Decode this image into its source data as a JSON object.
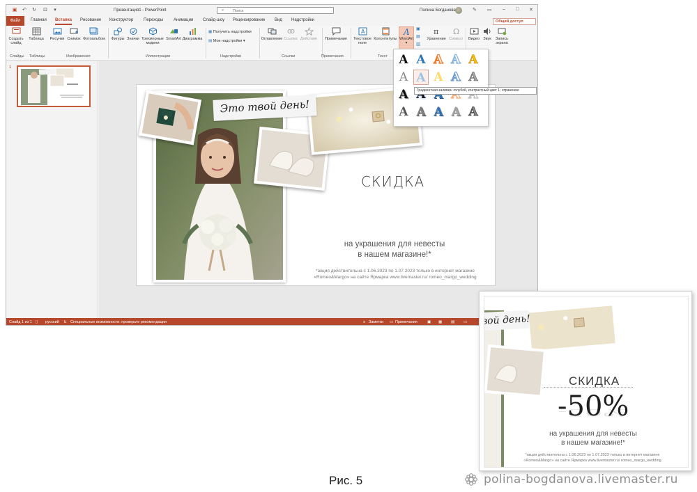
{
  "window": {
    "title": "Презентация1  -  PowerPoint",
    "search_placeholder": "Поиск",
    "user_name": "Полина Богданова",
    "share_label": "Общий доступ"
  },
  "tabs": [
    "Файл",
    "Главная",
    "Вставка",
    "Рисование",
    "Конструктор",
    "Переходы",
    "Анимация",
    "Слайд-шоу",
    "Рецензирование",
    "Вид",
    "Надстройки"
  ],
  "ribbon": {
    "buttons": {
      "new_slide": "Создать слайд",
      "table": "Таблица",
      "pictures": "Рисунки",
      "screenshot": "Снимок",
      "photo_album": "Фотоальбом",
      "shapes": "Фигуры",
      "icons": "Значки",
      "models_3d": "Трехмерные модели",
      "smartart": "SmartArt",
      "chart": "Диаграмма",
      "get_addins": "Получить надстройки",
      "my_addins": "Мои надстройки",
      "zoom": "Оглавление",
      "link": "Ссылка",
      "action": "Действие",
      "comment": "Примечание",
      "textbox": "Текстовое поле",
      "header_footer": "Колонтитулы",
      "wordart": "WordArt",
      "equation": "Уравнение",
      "symbol": "Символ",
      "video": "Видео",
      "audio": "Звук",
      "screen_recording": "Запись экрана"
    },
    "groups": {
      "slides": "Слайды",
      "tables": "Таблицы",
      "images": "Изображения",
      "illustrations": "Иллюстрации",
      "addins": "Надстройки",
      "links": "Ссылки",
      "comments": "Примечания",
      "text": "Текст"
    }
  },
  "thumbnails": {
    "slide_number": "1"
  },
  "slide": {
    "banner": "Это твой день!",
    "heading": "СКИДКА",
    "subtitle_line1": "на украшения для невесты",
    "subtitle_line2": "в нашем магазине!*",
    "footnote_line1": "*акция действительна с 1.06.2023 по 1.07.2023 только в интернет магазине",
    "footnote_line2": "«Romeo&Margo» на сайте Ярмарка www.livemaster.ru/ romeo_margo_wedding"
  },
  "wordart_menu": {
    "glyph": "A",
    "tooltip": "Градиентная заливка: голубой, контрастный цвет 1; отражение"
  },
  "status": {
    "slide_info": "Слайд 1 из 1",
    "language": "русский",
    "accessibility": "Специальные возможности: проверьте рекомендации",
    "notes": "Заметки",
    "comments": "Примечания"
  },
  "result": {
    "banner": "вой день!",
    "heading": "СКИДКА",
    "percent": "-50%",
    "subtitle_line1": "на украшения для невесты",
    "subtitle_line2": "в нашем магазине!*",
    "footnote_line1": "*акция действительна с 1.06.2023 по 1.07.2023 только в интернет магазине",
    "footnote_line2": "«Romeo&Margo» на сайте Ярмарка www.livemaster.ru/ romeo_margo_wedding"
  },
  "caption": "Рис. 5",
  "watermark": "polina-bogdanova.livemaster.ru",
  "colors": {
    "accent": "#b7472a",
    "wordart_blue": "#2e75b6",
    "wordart_orange": "#ed7d31",
    "wordart_gold": "#ffc000"
  }
}
